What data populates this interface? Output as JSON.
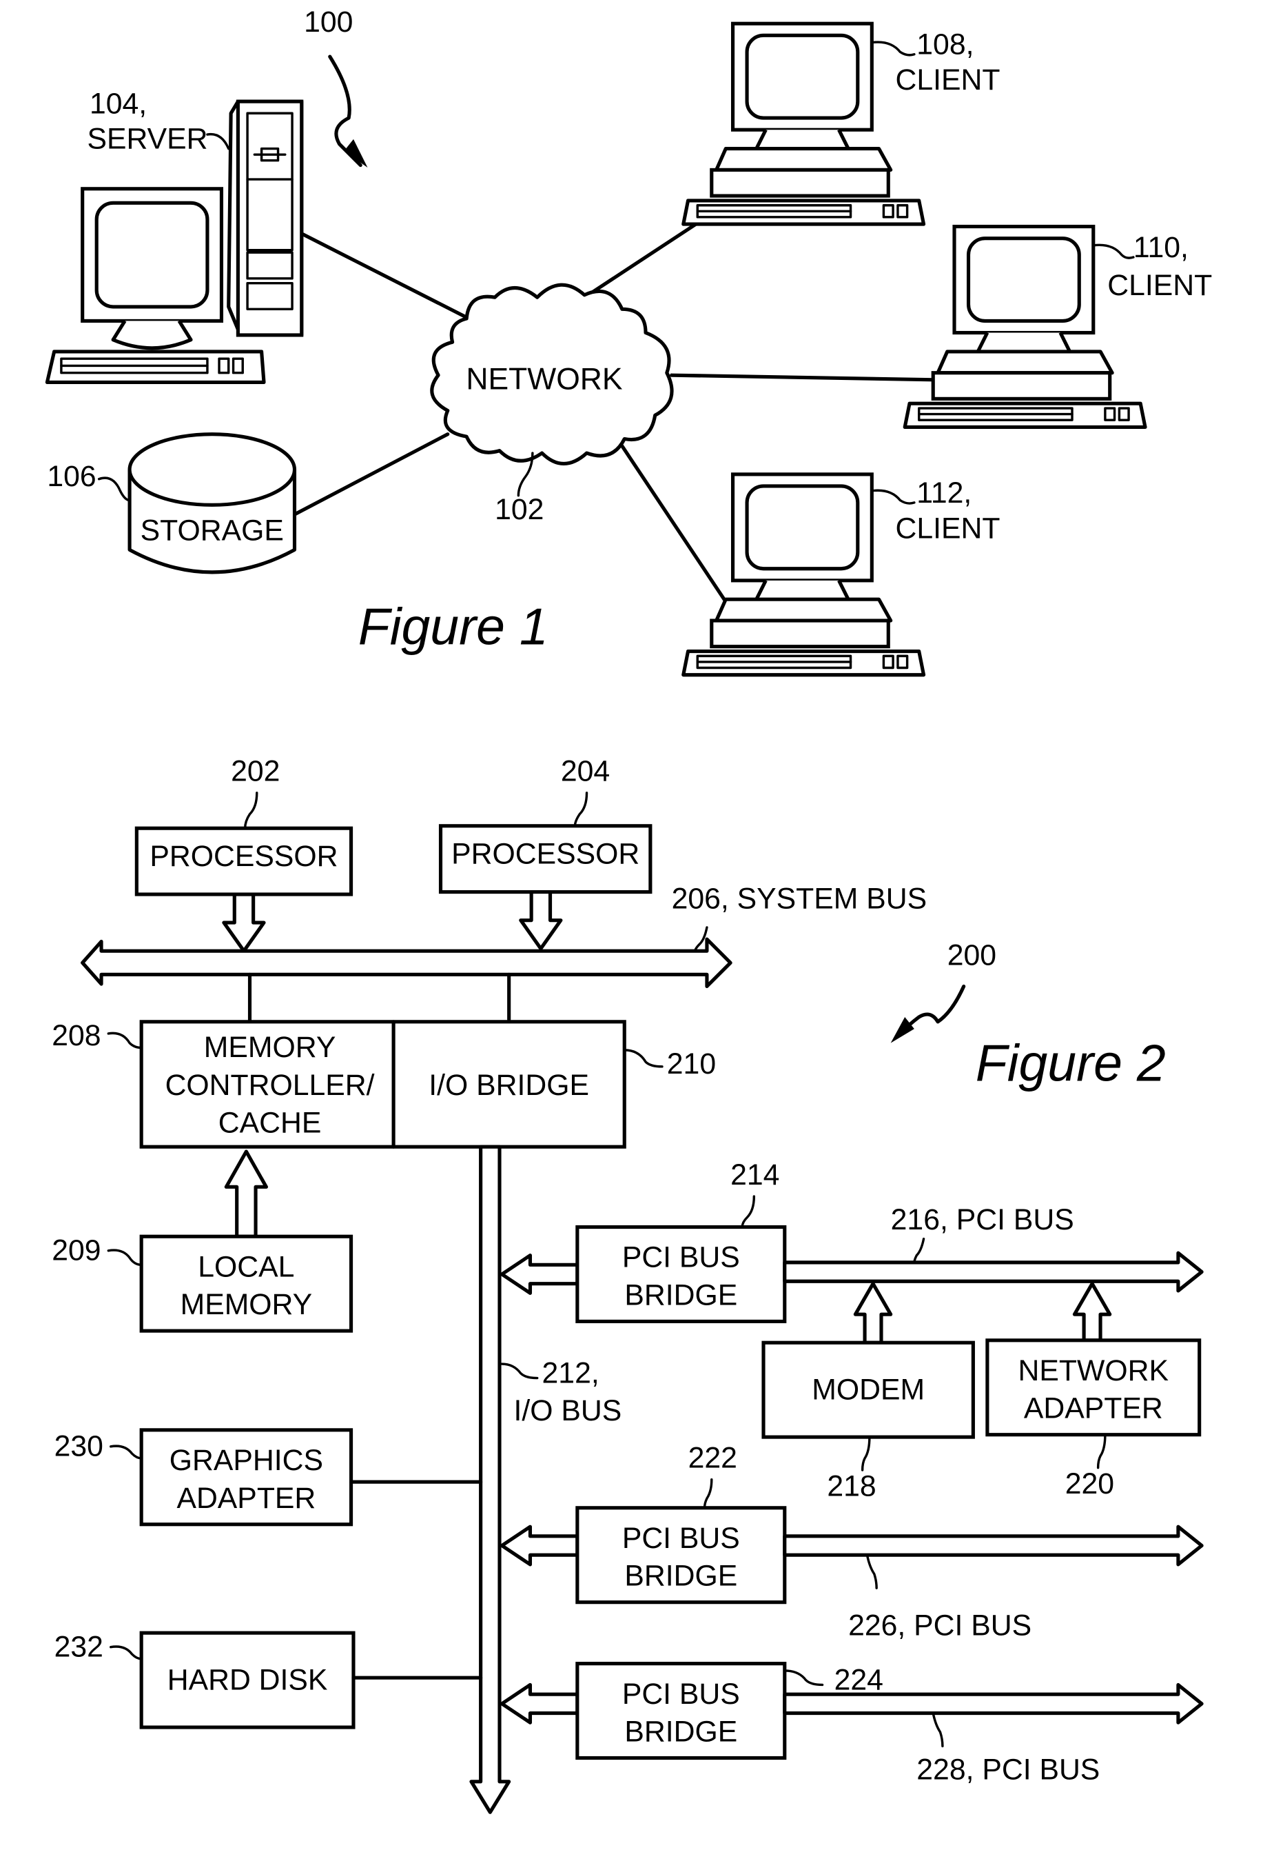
{
  "figure1": {
    "caption": "Figure 1",
    "system_ref": "100",
    "server": {
      "ref": "104,",
      "label": "SERVER"
    },
    "network": {
      "label": "NETWORK",
      "ref": "102"
    },
    "storage": {
      "ref": "106",
      "label": "STORAGE"
    },
    "clients": [
      {
        "ref": "108,",
        "label": "CLIENT"
      },
      {
        "ref": "110,",
        "label": "CLIENT"
      },
      {
        "ref": "112,",
        "label": "CLIENT"
      }
    ]
  },
  "figure2": {
    "caption": "Figure 2",
    "system_ref": "200",
    "processors": [
      {
        "ref": "202",
        "label": "PROCESSOR"
      },
      {
        "ref": "204",
        "label": "PROCESSOR"
      }
    ],
    "system_bus": {
      "label": "206, SYSTEM BUS"
    },
    "memory_controller": {
      "ref": "208",
      "lines": [
        "MEMORY",
        "CONTROLLER/",
        "CACHE"
      ]
    },
    "io_bridge": {
      "ref": "210",
      "label": "I/O BRIDGE"
    },
    "local_memory": {
      "ref": "209",
      "lines": [
        "LOCAL",
        "MEMORY"
      ]
    },
    "io_bus": {
      "ref": "212,",
      "label": "I/O BUS"
    },
    "graphics_adapter": {
      "ref": "230",
      "lines": [
        "GRAPHICS",
        "ADAPTER"
      ]
    },
    "hard_disk": {
      "ref": "232",
      "label": "HARD DISK"
    },
    "pci_bridges": [
      {
        "ref": "214",
        "lines": [
          "PCI BUS",
          "BRIDGE"
        ],
        "bus_label": "216, PCI BUS"
      },
      {
        "ref": "222",
        "lines": [
          "PCI BUS",
          "BRIDGE"
        ],
        "bus_label": "226, PCI BUS"
      },
      {
        "ref": "224",
        "lines": [
          "PCI BUS",
          "BRIDGE"
        ],
        "bus_label": "228, PCI BUS"
      }
    ],
    "modem": {
      "ref": "218",
      "label": "MODEM"
    },
    "network_adapter": {
      "ref": "220",
      "lines": [
        "NETWORK",
        "ADAPTER"
      ]
    }
  }
}
